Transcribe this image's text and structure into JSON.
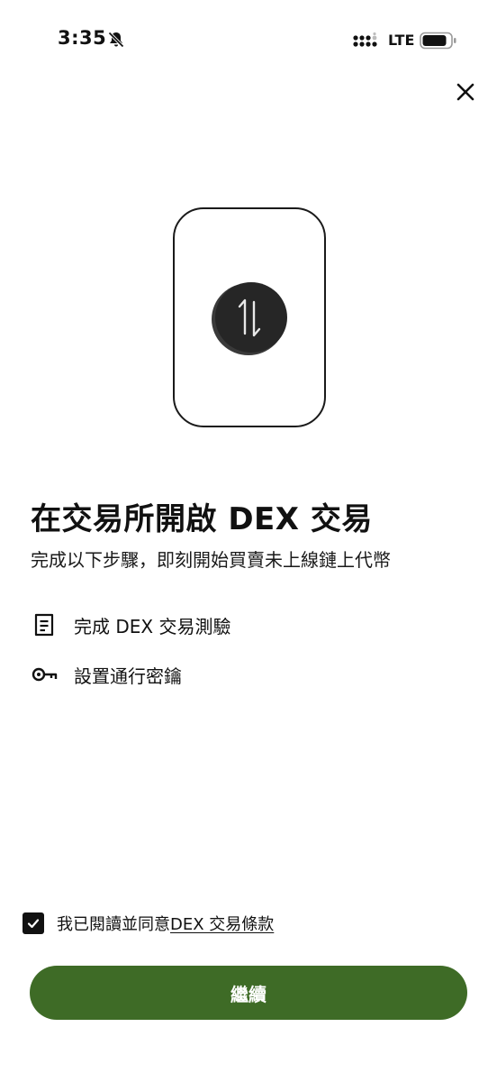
{
  "status_bar": {
    "time": "3:35",
    "network": "LTE",
    "icons": [
      "bell-slash-icon",
      "signal-icon",
      "battery-icon"
    ]
  },
  "header": {
    "close_icon": "close-icon"
  },
  "illustration": {
    "icon": "swap-arrows-icon"
  },
  "content": {
    "title": "在交易所開啟 DEX 交易",
    "subtitle": "完成以下步驟，即刻開始買賣未上線鏈上代幣",
    "steps": [
      {
        "icon": "quiz-document-icon",
        "label": "完成 DEX 交易測驗"
      },
      {
        "icon": "key-icon",
        "label": "設置通行密鑰"
      }
    ]
  },
  "agreement": {
    "checked": true,
    "text": "我已閱讀並同意",
    "link_text": "DEX 交易條款"
  },
  "footer": {
    "continue_label": "繼續"
  },
  "colors": {
    "primary": "#3e6b26",
    "text": "#111111",
    "background": "#ffffff"
  }
}
